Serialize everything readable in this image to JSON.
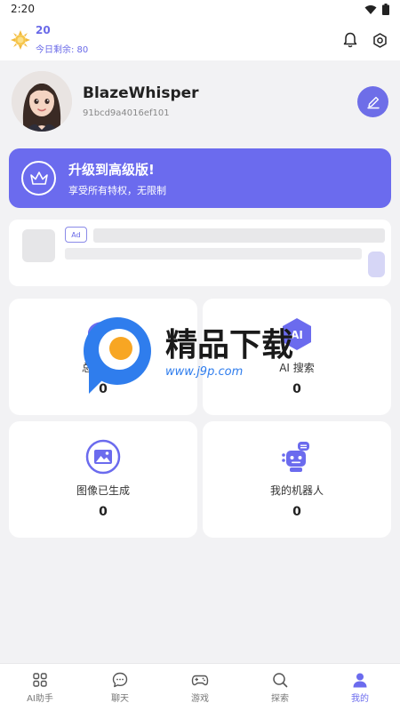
{
  "status_bar": {
    "time": "2:20"
  },
  "top_bar": {
    "credits_count": "20",
    "credits_remaining": "今日剩余: 80"
  },
  "profile": {
    "username": "BlazeWhisper",
    "user_id": "91bcd9a4016ef101"
  },
  "upgrade": {
    "title": "升级到高级版!",
    "subtitle": "享受所有特权，无限制"
  },
  "ad": {
    "badge": "Ad"
  },
  "stats": {
    "messages": {
      "label": "总消息数",
      "value": "0"
    },
    "ai_search": {
      "label": "AI 搜索",
      "value": "0"
    },
    "images": {
      "label": "图像已生成",
      "value": "0"
    },
    "bots": {
      "label": "我的机器人",
      "value": "0"
    }
  },
  "watermark": {
    "title": "精品下载",
    "url": "www.j9p.com"
  },
  "bottom_nav": [
    {
      "label": "AI助手",
      "icon": "grid-icon"
    },
    {
      "label": "聊天",
      "icon": "chat-icon"
    },
    {
      "label": "游戏",
      "icon": "gamepad-icon"
    },
    {
      "label": "探索",
      "icon": "search-icon"
    },
    {
      "label": "我的",
      "icon": "person-icon",
      "active": true
    }
  ],
  "colors": {
    "accent": "#6b6bee",
    "background": "#f2f2f4",
    "card": "#ffffff"
  }
}
